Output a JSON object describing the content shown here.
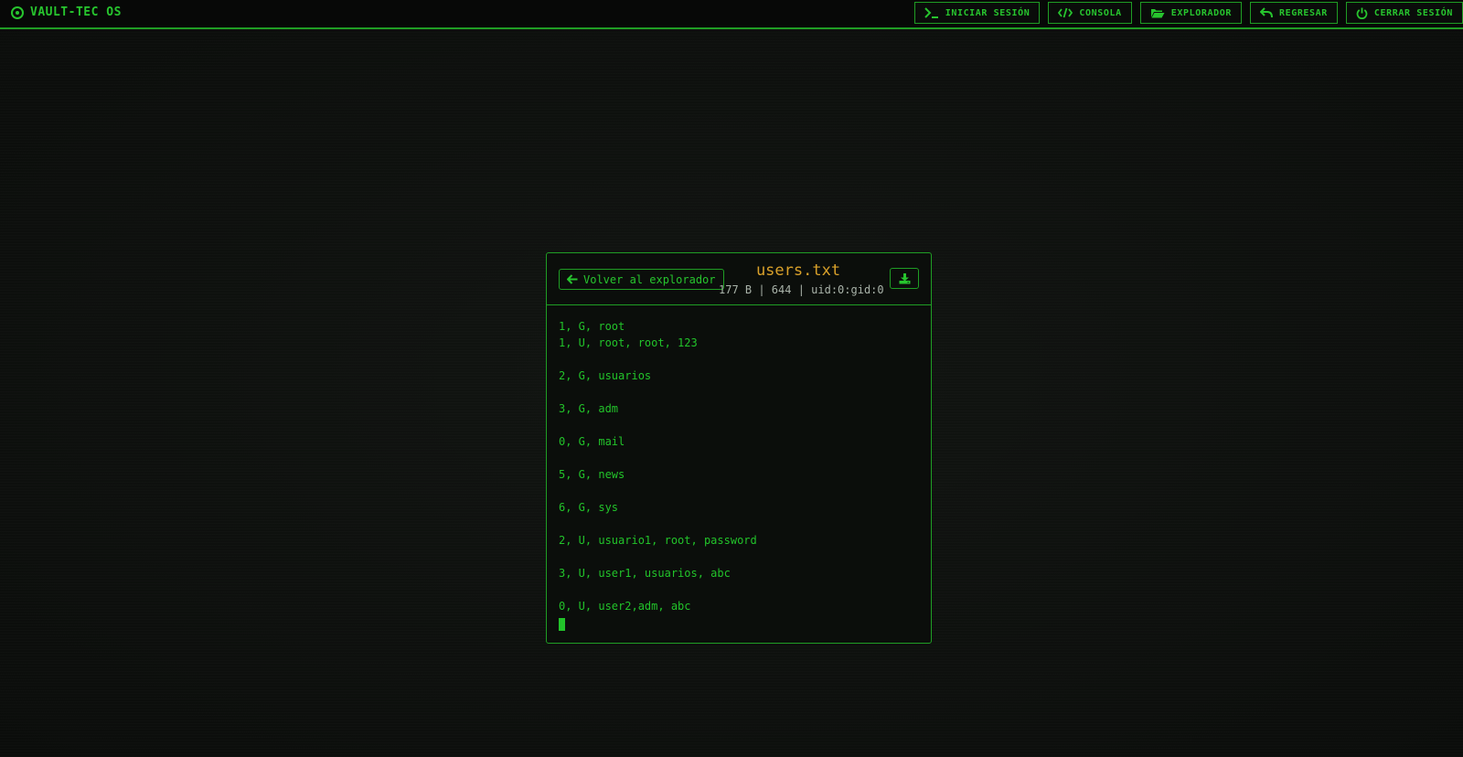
{
  "app": {
    "title": "VAULT-TEC OS"
  },
  "nav": {
    "items": [
      {
        "label": "INICIAR SESIÓN",
        "icon": "terminal-icon"
      },
      {
        "label": "CONSOLA",
        "icon": "code-icon"
      },
      {
        "label": "EXPLORADOR",
        "icon": "folder-open-icon"
      },
      {
        "label": "REGRESAR",
        "icon": "reply-icon"
      },
      {
        "label": "CERRAR SESIÓN",
        "icon": "power-icon"
      }
    ]
  },
  "viewer": {
    "back_label": "Volver al explorador",
    "back_icon": "arrow-left-icon",
    "filename": "users.txt",
    "meta": "177 B | 644 | uid:0:gid:0",
    "download_icon": "download-icon",
    "lines": [
      "1, G, root",
      "1, U, root, root, 123",
      "",
      "2, G, usuarios",
      "",
      "3, G, adm",
      "",
      "0, G, mail",
      "",
      "5, G, news",
      "",
      "6, G, sys",
      "",
      "2, U, usuario1, root, password",
      "",
      "3, U, user1, usuarios, abc",
      "",
      "0, U, user2,adm, abc"
    ]
  },
  "colors": {
    "accent": "#27c52e",
    "border": "#1f9d24",
    "title": "#d9a12a",
    "meta": "#a9b3a9",
    "background": "#0c0e0c"
  }
}
